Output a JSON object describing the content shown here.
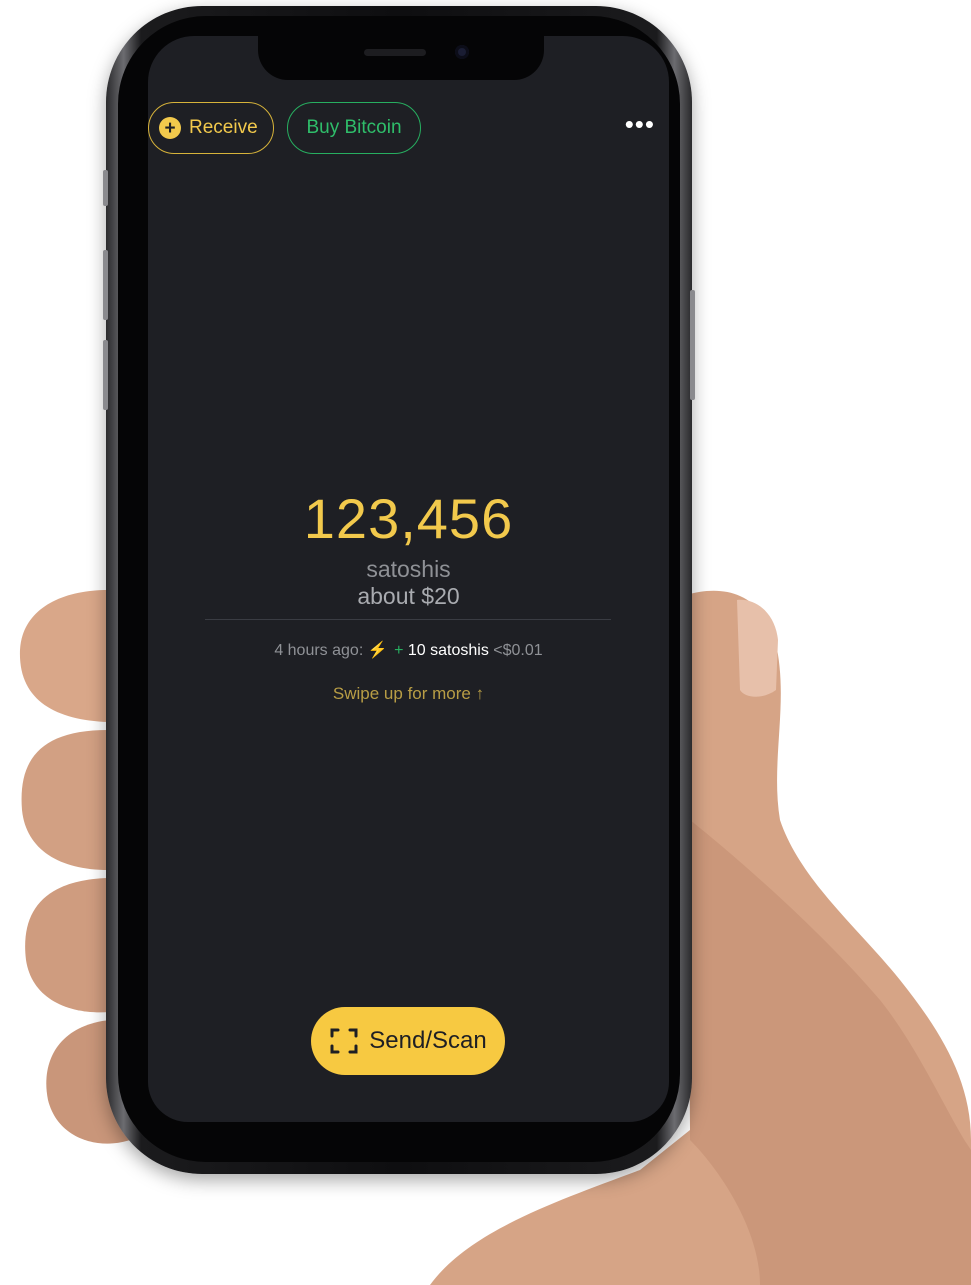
{
  "header": {
    "receive_label": "Receive",
    "buy_label": "Buy Bitcoin",
    "more_icon": "more-horizontal-icon"
  },
  "balance": {
    "amount": "123,456",
    "unit": "satoshis",
    "fiat": "about $20"
  },
  "last_activity": {
    "time": "4 hours ago:",
    "icon": "lightning-icon",
    "sign": "+",
    "amount": "10 satoshis",
    "fiat": "<$0.01"
  },
  "swipe_hint": "Swipe up for more",
  "send_button": {
    "label": "Send/Scan",
    "icon": "scan-icon"
  },
  "colors": {
    "background": "#1e1f24",
    "accent_yellow": "#f2c94c",
    "accent_green": "#27ae60",
    "muted_text": "#8f9196"
  }
}
